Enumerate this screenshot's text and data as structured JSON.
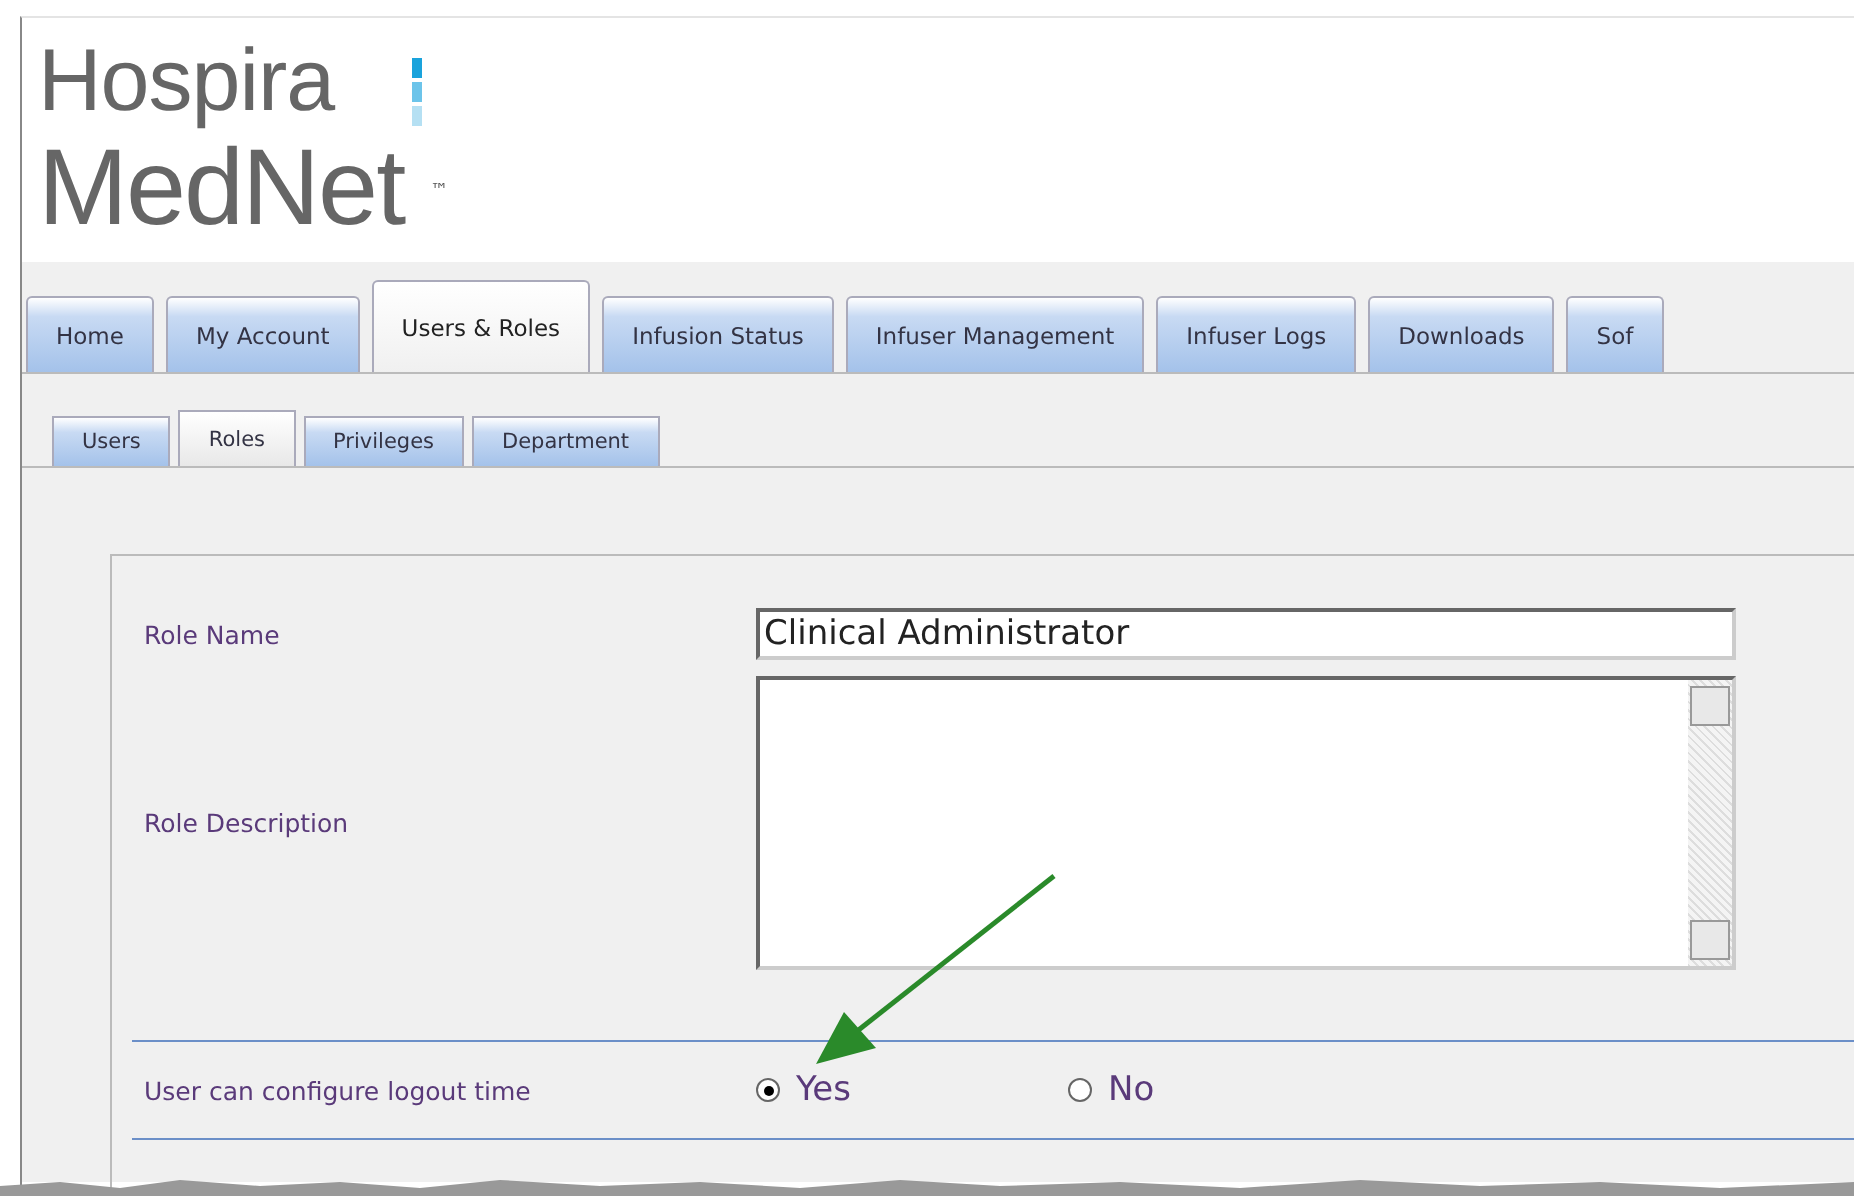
{
  "logo": {
    "line1": "Hospira",
    "line2": "MedNet",
    "mark": "™"
  },
  "tabs": [
    {
      "label": "Home",
      "selected": false
    },
    {
      "label": "My Account",
      "selected": false
    },
    {
      "label": "Users & Roles",
      "selected": true
    },
    {
      "label": "Infusion Status",
      "selected": false
    },
    {
      "label": "Infuser Management",
      "selected": false
    },
    {
      "label": "Infuser Logs",
      "selected": false
    },
    {
      "label": "Downloads",
      "selected": false
    },
    {
      "label": "Sof",
      "selected": false
    }
  ],
  "subtabs": [
    {
      "label": "Users",
      "selected": false
    },
    {
      "label": "Roles",
      "selected": true
    },
    {
      "label": "Privileges",
      "selected": false
    },
    {
      "label": "Department",
      "selected": false
    }
  ],
  "form": {
    "role_name": {
      "label": "Role Name",
      "value": "Clinical Administrator"
    },
    "role_description": {
      "label": "Role Description"
    },
    "logout": {
      "label": "User can configure logout time",
      "options": [
        {
          "label": "Yes",
          "selected": true
        },
        {
          "label": "No",
          "selected": false
        }
      ]
    }
  }
}
